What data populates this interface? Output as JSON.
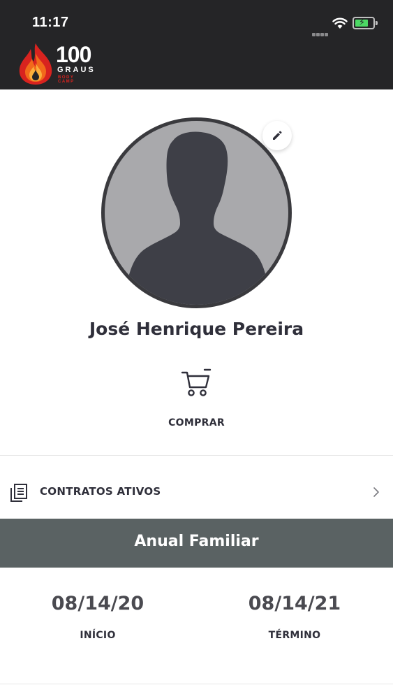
{
  "status_bar": {
    "time": "11:17"
  },
  "header": {
    "logo_number": "100",
    "logo_word": "GRAUS",
    "logo_sub": "BODY CAMP"
  },
  "profile": {
    "name": "José Henrique Pereira"
  },
  "actions": {
    "buy_label": "COMPRAR"
  },
  "contracts": {
    "section_label": "CONTRATOS ATIVOS",
    "plan_name": "Anual Familiar",
    "start_date": "08/14/20",
    "start_label": "INÍCIO",
    "end_date": "08/14/21",
    "end_label": "TÉRMINO"
  },
  "colors": {
    "header_bg": "#252527",
    "plan_band_bg": "#5a6263",
    "text_dark": "#2f2f3a",
    "brand_red": "#d8231f",
    "battery_green": "#4cd964"
  },
  "icons": {
    "edit": "pencil-icon",
    "cart": "cart-icon",
    "contracts": "documents-icon",
    "chevron": "chevron-right-icon",
    "wifi": "wifi-icon",
    "battery": "battery-charging-icon",
    "signal": "cellular-signal-icon"
  }
}
